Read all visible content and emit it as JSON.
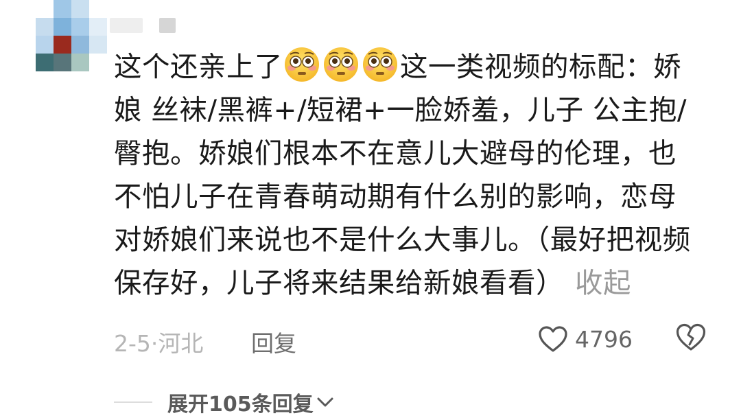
{
  "comment": {
    "segments": {
      "lead": "这个还亲上了",
      "line1_rest": "这一类视频的标配：娇",
      "body": "娘  丝袜/黑裤+/短裙+一脸娇羞，儿子 公主抱/臀抱。娇娘们根本不在意儿大避母的伦理，也不怕儿子在青春萌动期有什么别的影响，恋母对娇娘们来说也不是什么大事儿。（最好把视频保存好，儿子将来结果给新娘看看）"
    },
    "emoji_name": "flushed-face-emoji",
    "collapse_label": "收起"
  },
  "meta": {
    "date_location": "2-5·河北",
    "reply_label": "回复",
    "like_count": "4796"
  },
  "expand": {
    "label": "展开105条回复"
  },
  "colors": {
    "text": "#1a1a1a",
    "muted": "#b5b5b5",
    "secondary": "#6e6e6e"
  }
}
